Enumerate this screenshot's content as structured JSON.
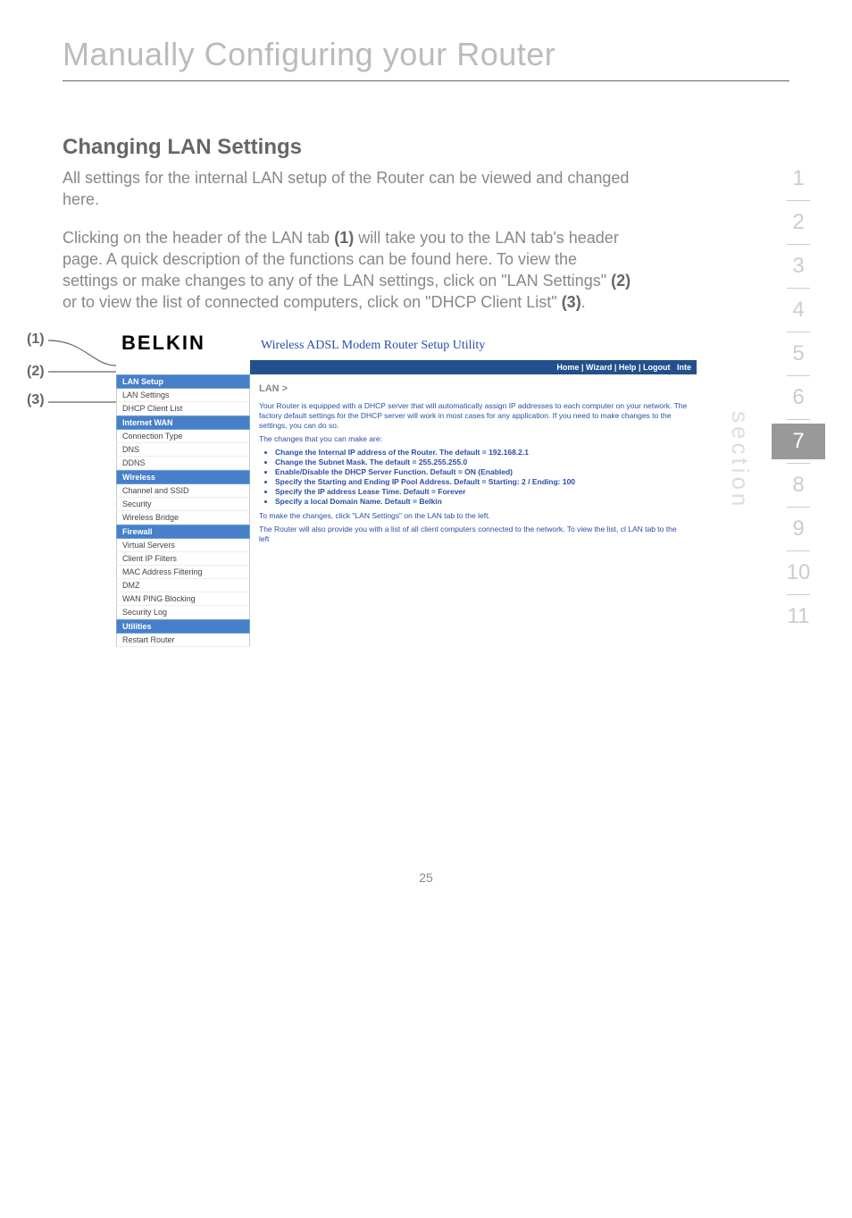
{
  "chapter": {
    "title": "Manually Configuring your Router"
  },
  "heading": "Changing LAN Settings",
  "paragraph1": "All settings for the internal LAN setup of the Router can be viewed and changed here.",
  "paragraph2a": "Clicking on the header of the LAN tab ",
  "ref1": "(1)",
  "paragraph2b": " will take you to the LAN tab's header page. A quick description of the functions can be found here. To view the settings or make changes to any of the LAN settings, click on \"LAN Settings\" ",
  "ref2": "(2)",
  "paragraph2c": " or to view the list of connected computers, click on \"DHCP Client List\" ",
  "ref3": "(3)",
  "paragraph2d": ".",
  "callouts": {
    "c1": "(1)",
    "c2": "(2)",
    "c3": "(3)"
  },
  "nav": {
    "items": [
      "1",
      "2",
      "3",
      "4",
      "5",
      "6",
      "7",
      "8",
      "9",
      "10",
      "11"
    ],
    "active_index": 6,
    "label": "section"
  },
  "screenshot": {
    "logo": "BELKIN",
    "tagline": "Wireless ADSL Modem Router Setup Utility",
    "topbar": {
      "home": "Home",
      "wizard": "Wizard",
      "help": "Help",
      "logout": "Logout",
      "internet": "Inte"
    },
    "side": {
      "groups": [
        {
          "cat": "LAN Setup",
          "items": [
            "LAN Settings",
            "DHCP Client List"
          ]
        },
        {
          "cat": "Internet WAN",
          "items": [
            "Connection Type",
            "DNS",
            "DDNS"
          ]
        },
        {
          "cat": "Wireless",
          "items": [
            "Channel and SSID",
            "Security",
            "Wireless Bridge"
          ]
        },
        {
          "cat": "Firewall",
          "items": [
            "Virtual Servers",
            "Client IP Filters",
            "MAC Address Filtering",
            "DMZ",
            "WAN PING Blocking",
            "Security Log"
          ]
        },
        {
          "cat": "Utilities",
          "items": [
            "Restart Router"
          ]
        }
      ]
    },
    "main": {
      "breadcrumb": "LAN >",
      "intro1": "Your Router is equipped with a DHCP server that will automatically assign IP addresses to each computer on your network. The factory default settings for the DHCP server will work in most cases for any application. If you need to make changes to the settings, you can do so.",
      "intro2": "The changes that you can make are:",
      "bullets": [
        "Change the Internal IP address of the Router. The default = 192.168.2.1",
        "Change the Subnet Mask. The default = 255.255.255.0",
        "Enable/Disable the DHCP Server Function. Default = ON (Enabled)",
        "Specify the Starting and Ending IP Pool Address. Default = Starting: 2 / Ending: 100",
        "Specify the IP address Lease Time. Default = Forever",
        "Specify a local Domain Name. Default = Belkin"
      ],
      "line1": "To make the changes, click \"LAN Settings\" on the LAN tab to the left.",
      "line2": "The Router will also provide you with a list of all client computers connected to the network. To view the list, cl LAN tab to the left"
    }
  },
  "page_number": "25"
}
